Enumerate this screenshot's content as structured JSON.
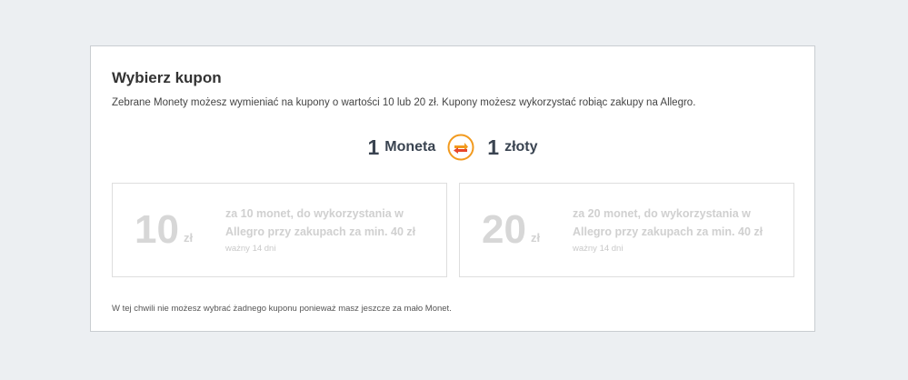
{
  "panel": {
    "title": "Wybierz kupon",
    "description": "Zebrane Monety możesz wymieniać na kupony o wartości 10 lub 20 zł. Kupony możesz wykorzystać robiąc zakupy na Allegro.",
    "notice": "W tej chwili nie możesz wybrać żadnego kuponu ponieważ masz jeszcze za mało Monet."
  },
  "rate": {
    "left_number": "1",
    "left_unit": "Moneta",
    "right_number": "1",
    "right_unit": "złoty",
    "icon": "coin-exchange-icon",
    "colors": {
      "coin_orange": "#f29a1e",
      "coin_red": "#e8472a"
    }
  },
  "coupons": [
    {
      "amount": "10",
      "currency": "zł",
      "description": "za 10 monet, do wykorzystania w Allegro przy zakupach za min. 40 zł",
      "validity": "ważny 14 dni"
    },
    {
      "amount": "20",
      "currency": "zł",
      "description": "za 20 monet, do wykorzystania w Allegro przy zakupach za min. 40 zł",
      "validity": "ważny 14 dni"
    }
  ]
}
